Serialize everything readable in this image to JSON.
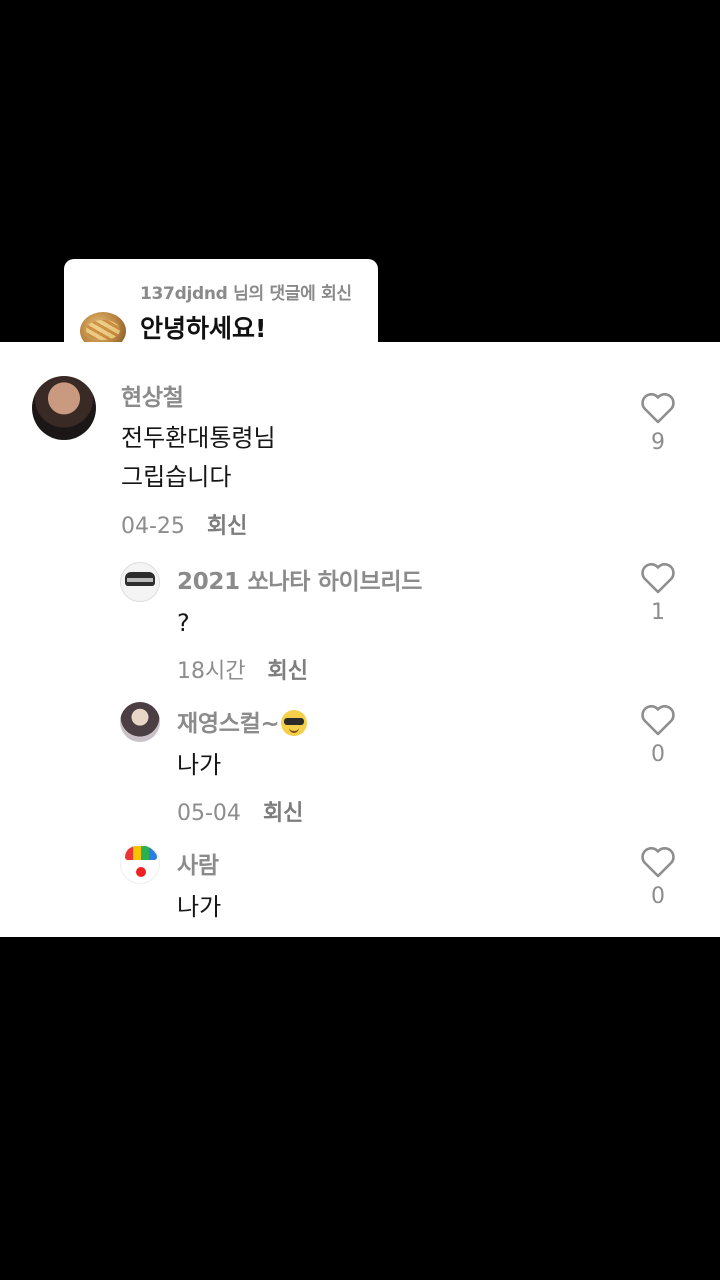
{
  "reply_card": {
    "meta": "137djdnd 님의 댓글에 회신",
    "text": "안녕하세요!"
  },
  "comments": [
    {
      "username": "현상철",
      "text_lines": [
        "전두환대통령님",
        "그립습니다"
      ],
      "date": "04-25",
      "reply_label": "회신",
      "likes": "9"
    }
  ],
  "replies": [
    {
      "username": "2021 쏘나타 하이브리드",
      "text": "?",
      "date": "18시간",
      "reply_label": "회신",
      "likes": "1"
    },
    {
      "username": "재영스컬~",
      "text": "나가",
      "date": "05-04",
      "reply_label": "회신",
      "likes": "0"
    },
    {
      "username": "사람",
      "text": "나가",
      "likes": "0"
    }
  ],
  "icons": {
    "like": "heart-outline-icon",
    "emoji": "sunglasses-emoji-icon"
  },
  "colors": {
    "background": "#000000",
    "panel": "#ffffff",
    "secondary_text": "#8b8b8b"
  }
}
